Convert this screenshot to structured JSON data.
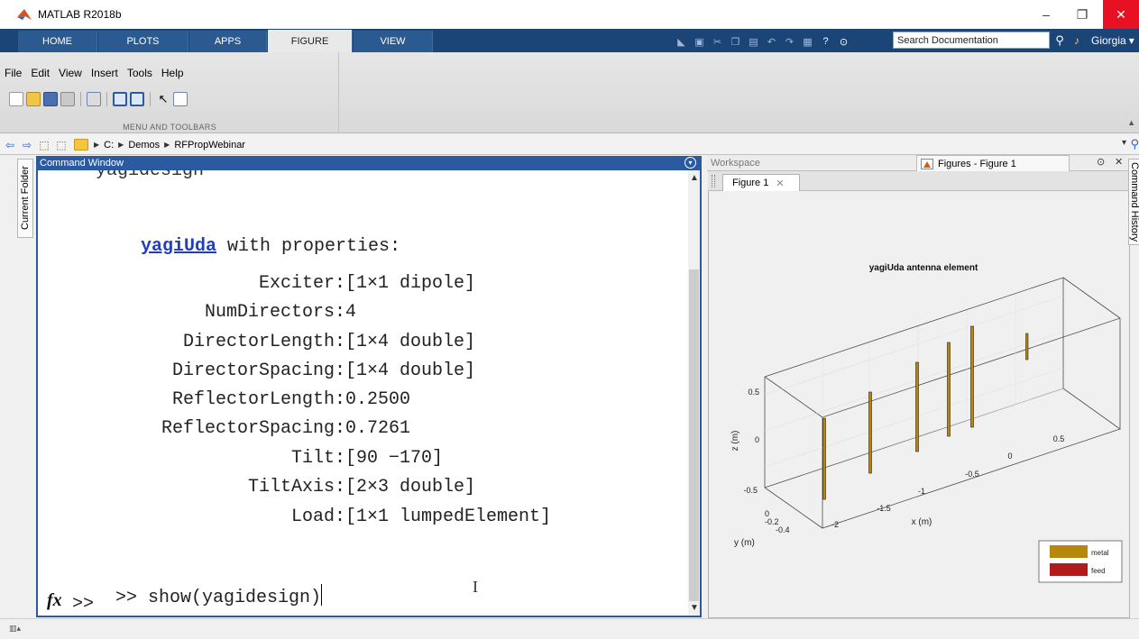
{
  "window": {
    "title": "MATLAB R2018b",
    "minimize": "–",
    "restore": "❐",
    "close": "✕"
  },
  "ribbon_tabs": [
    "HOME",
    "PLOTS",
    "APPS",
    "FIGURE",
    "VIEW"
  ],
  "search": {
    "placeholder": "Search Documentation",
    "icon": "search-icon"
  },
  "user": {
    "name": "Giorgia",
    "chevron": "▾"
  },
  "menu": [
    "File",
    "Edit",
    "View",
    "Insert",
    "Tools",
    "Help"
  ],
  "ribbon_group_label": "MENU AND TOOLBARS",
  "address": {
    "crumbs": [
      "C:",
      "Demos",
      "RFPropWebinar"
    ],
    "separator": "▶"
  },
  "left_tab": "Current Folder",
  "right_tab": "Command History",
  "command_window": {
    "title": "Command Window",
    "cut_text": "yagidesign",
    "class_link": "yagiUda",
    "header_rest": " with properties:",
    "properties": [
      {
        "name": "Exciter:",
        "value": "[1×1 dipole]"
      },
      {
        "name": "NumDirectors:",
        "value": "4"
      },
      {
        "name": "DirectorLength:",
        "value": "[1×4 double]"
      },
      {
        "name": "DirectorSpacing:",
        "value": "[1×4 double]"
      },
      {
        "name": "ReflectorLength:",
        "value": "0.2500"
      },
      {
        "name": "ReflectorSpacing:",
        "value": "0.7261"
      },
      {
        "name": "Tilt:",
        "value": "[90 −170]"
      },
      {
        "name": "TiltAxis:",
        "value": "[2×3 double]"
      },
      {
        "name": "Load:",
        "value": "[1×1 lumpedElement]"
      }
    ],
    "command": ">> show(yagidesign)",
    "prompt": ">>",
    "fx_label": "fx"
  },
  "right_panel": {
    "workspace_tab": "Workspace",
    "figures_tab": "Figures - Figure 1",
    "figure_tab": "Figure 1",
    "figure_tab_close": "✕"
  },
  "plot": {
    "title": "yagiUda antenna element",
    "zlabel": "z (m)",
    "xlabel": "x (m)",
    "ylabel": "y (m)",
    "z_ticks": [
      "0.5",
      "0",
      "-0.5"
    ],
    "x_ticks": [
      "-2",
      "-1.5",
      "-1",
      "-0.5",
      "0",
      "0.5"
    ],
    "y_ticks": [
      "0",
      "-0.2",
      "-0.4"
    ],
    "legend": [
      {
        "label": "metal",
        "color": "#b8860b"
      },
      {
        "label": "feed",
        "color": "#b01c1c"
      }
    ]
  },
  "colors": {
    "ribbon_dark": "#1b4477",
    "cw_header": "#2c5aa0",
    "link": "#1f3fbf"
  }
}
